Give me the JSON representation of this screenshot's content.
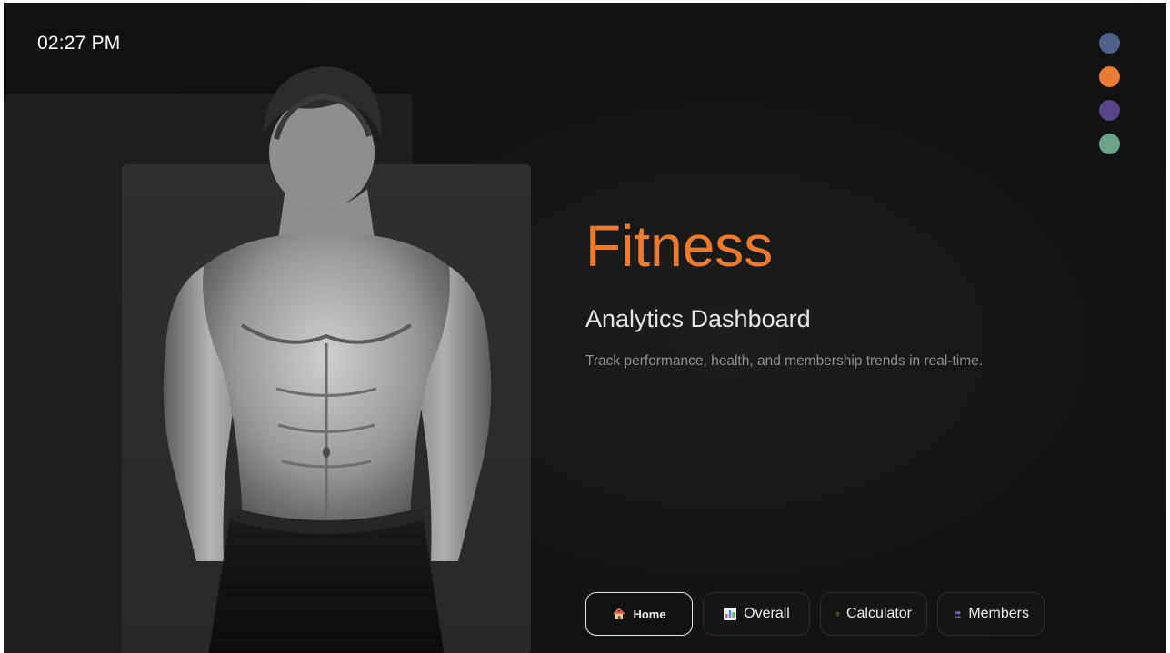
{
  "header": {
    "time": "02:27 PM"
  },
  "theme_switcher": {
    "swatches": [
      {
        "name": "slate-blue",
        "color": "#4f6189"
      },
      {
        "name": "orange",
        "color": "#ea7c35"
      },
      {
        "name": "purple",
        "color": "#5a4489"
      },
      {
        "name": "sage-green",
        "color": "#6aa488"
      }
    ]
  },
  "hero": {
    "title": "Fitness",
    "title_color": "#ee7a2e",
    "subtitle": "Analytics Dashboard",
    "description": "Track performance, health, and membership trends in real-time."
  },
  "nav": {
    "items": [
      {
        "label": "Home",
        "icon": "home-icon",
        "active": true
      },
      {
        "label": "Overall",
        "icon": "bar-chart-icon",
        "active": false
      },
      {
        "label": "Calculator",
        "icon": "scale-icon",
        "active": false
      },
      {
        "label": "Members",
        "icon": "members-icon",
        "active": false
      }
    ]
  }
}
